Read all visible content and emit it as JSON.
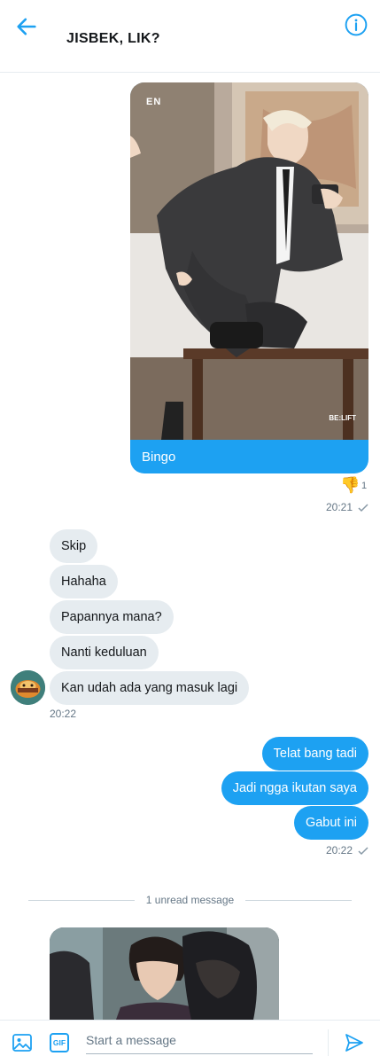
{
  "header": {
    "title": "JISBEK, LIK?",
    "back_icon": "arrow-left-icon",
    "info_icon": "info-icon"
  },
  "sent_media": {
    "caption": "Bingo",
    "watermark_top": "EN",
    "watermark_bottom": "BE:LIFT",
    "reaction_icon": "thumbs-down-icon",
    "reaction_count": "1",
    "time": "20:21"
  },
  "received_group": {
    "messages": [
      "Skip",
      "Hahaha",
      "Papannya mana?",
      "Nanti keduluan",
      "Kan udah ada yang masuk lagi"
    ],
    "time": "20:22"
  },
  "sent_group": {
    "messages": [
      "Telat bang tadi",
      "Jadi ngga ikutan saya",
      "Gabut ini"
    ],
    "time": "20:22"
  },
  "unread_divider": {
    "label": "1 unread message"
  },
  "composer": {
    "placeholder": "Start a message",
    "gif_label": "GIF",
    "image_icon": "image-icon",
    "send_icon": "send-icon"
  },
  "colors": {
    "accent": "#1da1f2",
    "incoming_bubble": "#e6ecf0",
    "meta_text": "#657786"
  }
}
